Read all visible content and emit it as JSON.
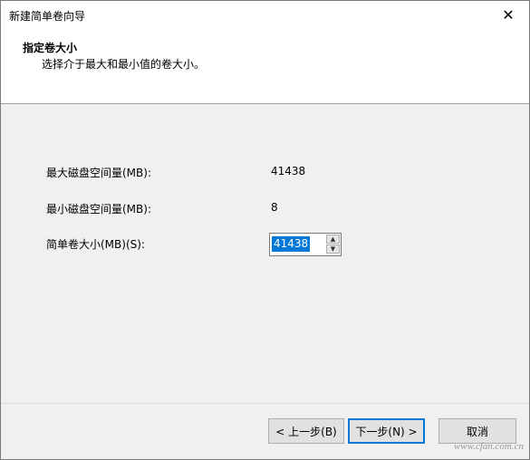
{
  "window": {
    "title": "新建简单卷向导",
    "close_glyph": "✕"
  },
  "header": {
    "title": "指定卷大小",
    "subtitle": "选择介于最大和最小值的卷大小。"
  },
  "fields": {
    "max_label": "最大磁盘空间量(MB):",
    "max_value": "41438",
    "min_label": "最小磁盘空间量(MB):",
    "min_value": "8",
    "size_label": "简单卷大小(MB)(S):",
    "size_value": "41438"
  },
  "buttons": {
    "back": "< 上一步(B)",
    "next": "下一步(N) >",
    "cancel": "取消"
  },
  "watermark": "www.cfan.com.cn"
}
